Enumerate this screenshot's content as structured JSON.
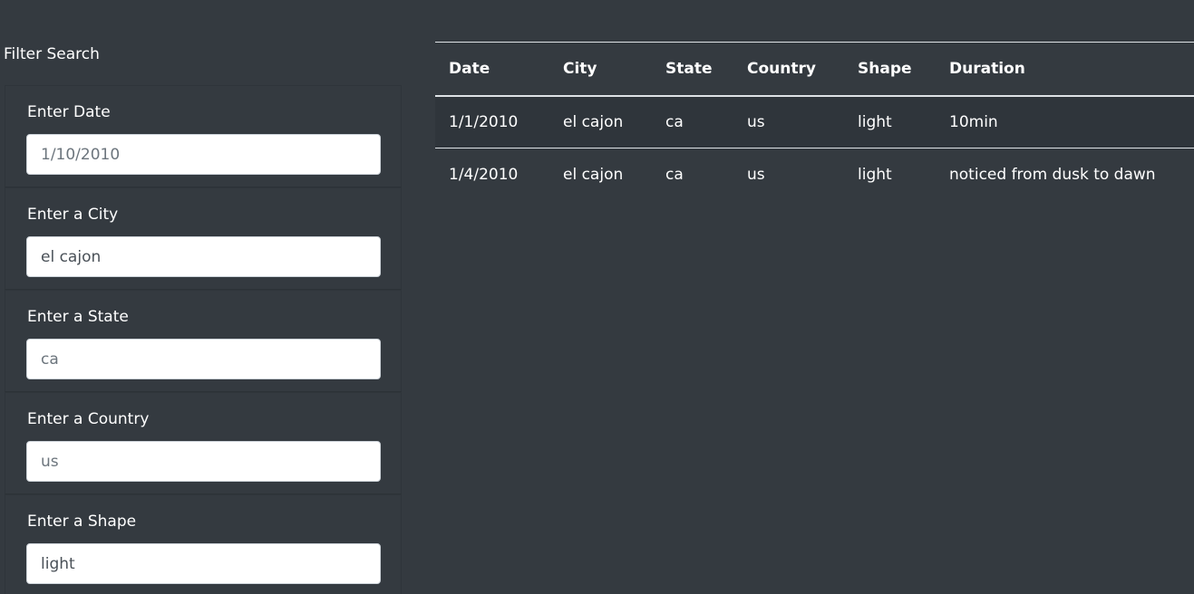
{
  "filters": {
    "title": "Filter Search",
    "items": [
      {
        "label": "Enter Date",
        "value": "",
        "placeholder": "1/10/2010"
      },
      {
        "label": "Enter a City",
        "value": "el cajon",
        "placeholder": ""
      },
      {
        "label": "Enter a State",
        "value": "",
        "placeholder": "ca"
      },
      {
        "label": "Enter a Country",
        "value": "",
        "placeholder": "us"
      },
      {
        "label": "Enter a Shape",
        "value": "light",
        "placeholder": ""
      }
    ]
  },
  "table": {
    "headers": [
      "Date",
      "City",
      "State",
      "Country",
      "Shape",
      "Duration"
    ],
    "rows": [
      [
        "1/1/2010",
        "el cajon",
        "ca",
        "us",
        "light",
        "10min"
      ],
      [
        "1/4/2010",
        "el cajon",
        "ca",
        "us",
        "light",
        "noticed from dusk to dawn"
      ]
    ]
  }
}
